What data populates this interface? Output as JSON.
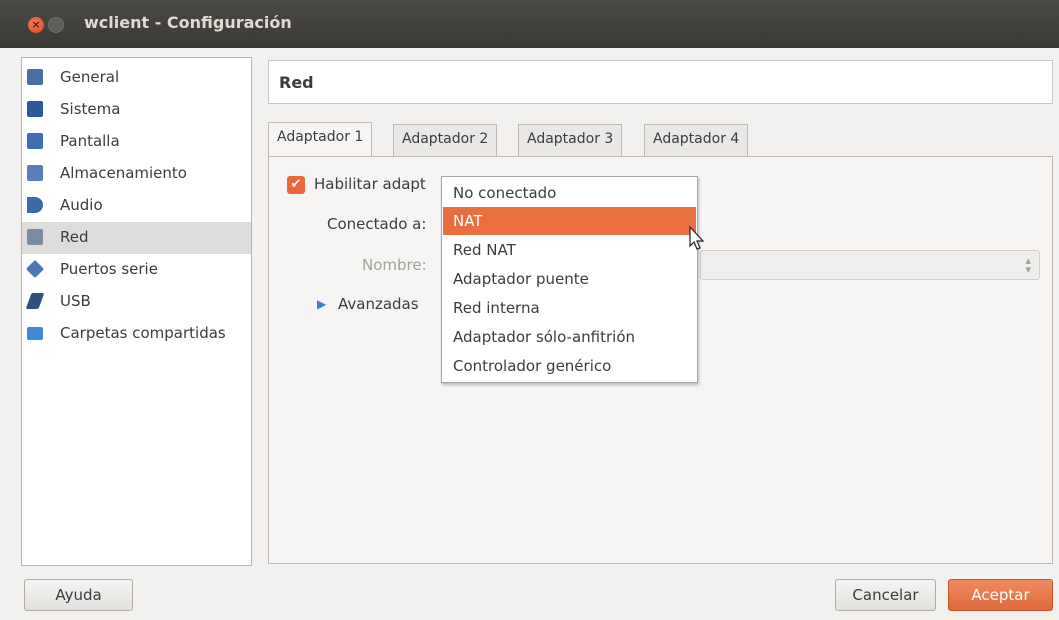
{
  "window": {
    "title": "wclient - Configuración",
    "close_glyph": "×"
  },
  "sidebar": {
    "items": [
      {
        "label": "General",
        "icon": "monitor-icon",
        "color": "#4a6fa5"
      },
      {
        "label": "Sistema",
        "icon": "chip-icon",
        "color": "#2d5b9a"
      },
      {
        "label": "Pantalla",
        "icon": "display-icon",
        "color": "#3f6fb0"
      },
      {
        "label": "Almacenamiento",
        "icon": "storage-icon",
        "color": "#5a7fb8"
      },
      {
        "label": "Audio",
        "icon": "speaker-icon",
        "color": "#3a6aa8"
      },
      {
        "label": "Red",
        "icon": "network-icon",
        "color": "#7a8aa0"
      },
      {
        "label": "Puertos serie",
        "icon": "serial-port-icon",
        "color": "#4b78b5"
      },
      {
        "label": "USB",
        "icon": "usb-icon",
        "color": "#2f4f7f"
      },
      {
        "label": "Carpetas compartidas",
        "icon": "folder-icon",
        "color": "#3c8ad6"
      }
    ],
    "active": "Red"
  },
  "main": {
    "header_title": "Red",
    "tabs": [
      "Adaptador 1",
      "Adaptador 2",
      "Adaptador 3",
      "Adaptador 4"
    ],
    "active_tab": "Adaptador 1",
    "enable_label": "Habilitar adapt",
    "enable_checked": true,
    "connected_label": "Conectado a:",
    "name_label": "Nombre:",
    "advanced_label": "Avanzadas"
  },
  "dropdown": {
    "options": [
      "No conectado",
      "NAT",
      "Red NAT",
      "Adaptador puente",
      "Red interna",
      "Adaptador sólo-anfitrión",
      "Controlador genérico"
    ],
    "selected": "NAT",
    "accent": "#e9703e"
  },
  "buttons": {
    "help": "Ayuda",
    "cancel": "Cancelar",
    "ok": "Aceptar"
  }
}
